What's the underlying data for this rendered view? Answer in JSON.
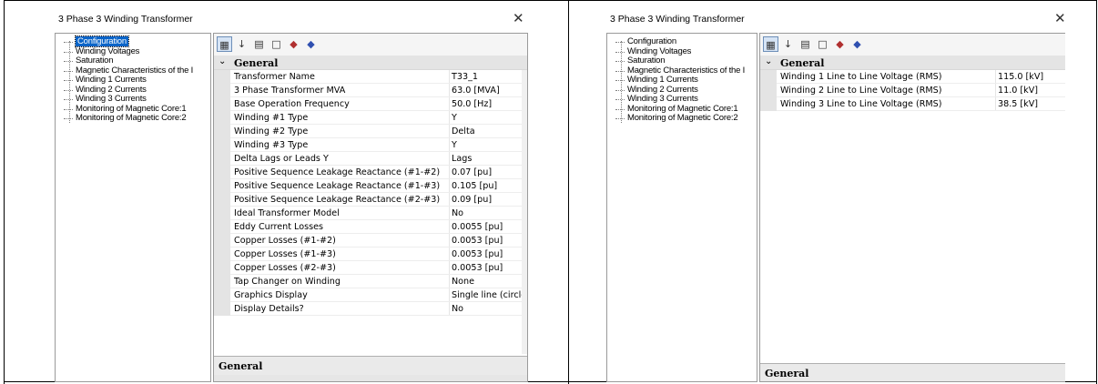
{
  "left": {
    "title": "3 Phase 3 Winding Transformer",
    "close_glyph": "✕",
    "tree": [
      {
        "label": "Configuration",
        "selected": true
      },
      {
        "label": "Winding Voltages"
      },
      {
        "label": "Saturation"
      },
      {
        "label": "Magnetic Characteristics of the I"
      },
      {
        "label": "Winding 1 Currents"
      },
      {
        "label": "Winding 2 Currents"
      },
      {
        "label": "Winding 3 Currents"
      },
      {
        "label": "Monitoring of Magnetic Core:1"
      },
      {
        "label": "Monitoring of Magnetic Core:2"
      }
    ],
    "toolbar": [
      "categorized-icon",
      "alphabetical-sort-icon",
      "property-pages-icon",
      "new-page-icon",
      "pin-icon",
      "unpin-icon"
    ],
    "category": "General",
    "rows": [
      {
        "name": "Transformer Name",
        "value": "T33_1"
      },
      {
        "name": "3 Phase Transformer MVA",
        "value": "63.0 [MVA]"
      },
      {
        "name": "Base Operation Frequency",
        "value": "50.0 [Hz]"
      },
      {
        "name": "Winding #1 Type",
        "value": "Y"
      },
      {
        "name": "Winding #2 Type",
        "value": "Delta"
      },
      {
        "name": "Winding #3 Type",
        "value": "Y"
      },
      {
        "name": "Delta Lags or Leads Y",
        "value": "Lags"
      },
      {
        "name": "Positive Sequence Leakage Reactance (#1-#2)",
        "value": "0.07 [pu]"
      },
      {
        "name": "Positive Sequence Leakage Reactance (#1-#3)",
        "value": "0.105 [pu]"
      },
      {
        "name": "Positive Sequence Leakage Reactance (#2-#3)",
        "value": "0.09 [pu]"
      },
      {
        "name": "Ideal Transformer Model",
        "value": "No"
      },
      {
        "name": "Eddy Current Losses",
        "value": "0.0055 [pu]"
      },
      {
        "name": "Copper Losses (#1-#2)",
        "value": "0.0053 [pu]"
      },
      {
        "name": "Copper Losses (#1-#3)",
        "value": "0.0053 [pu]"
      },
      {
        "name": "Copper Losses (#2-#3)",
        "value": "0.0053 [pu]"
      },
      {
        "name": "Tap Changer on Winding",
        "value": "None"
      },
      {
        "name": "Graphics Display",
        "value": "Single line (circles)"
      },
      {
        "name": "Display Details?",
        "value": "No"
      }
    ],
    "description_title": "General"
  },
  "right": {
    "title": "3 Phase 3 Winding Transformer",
    "close_glyph": "✕",
    "tree": [
      {
        "label": "Configuration"
      },
      {
        "label": "Winding Voltages",
        "selected": true
      },
      {
        "label": "Saturation"
      },
      {
        "label": "Magnetic Characteristics of the I"
      },
      {
        "label": "Winding 1 Currents"
      },
      {
        "label": "Winding 2 Currents"
      },
      {
        "label": "Winding 3 Currents"
      },
      {
        "label": "Monitoring of Magnetic Core:1"
      },
      {
        "label": "Monitoring of Magnetic Core:2"
      }
    ],
    "category": "General",
    "rows": [
      {
        "name": "Winding 1 Line to Line Voltage (RMS)",
        "value": "115.0 [kV]"
      },
      {
        "name": "Winding 2 Line to Line Voltage (RMS)",
        "value": "11.0 [kV]"
      },
      {
        "name": "Winding 3 Line to Line Voltage (RMS)",
        "value": "38.5 [kV]"
      }
    ],
    "description_title": "General"
  },
  "colors": {
    "selection": "#0a64c8",
    "category_bg": "#e4e4e4"
  }
}
